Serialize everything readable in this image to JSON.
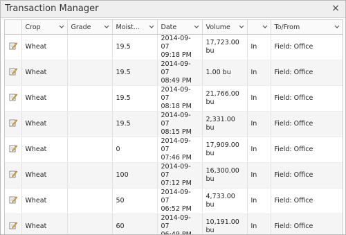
{
  "window": {
    "title": "Transaction Manager",
    "close_glyph": "×"
  },
  "columns": [
    {
      "label": ""
    },
    {
      "label": "Crop"
    },
    {
      "label": "Grade"
    },
    {
      "label": "Moist..."
    },
    {
      "label": "Date"
    },
    {
      "label": "Volume"
    },
    {
      "label": ""
    },
    {
      "label": "To/From"
    }
  ],
  "rows": [
    {
      "crop": "Wheat",
      "grade": "",
      "moisture": "19.5",
      "date": "2014-09-07",
      "time": "09:18 PM",
      "volume": "17,723.00 bu",
      "direction": "In",
      "to_from": "Field: Office"
    },
    {
      "crop": "Wheat",
      "grade": "",
      "moisture": "19.5",
      "date": "2014-09-07",
      "time": "08:49 PM",
      "volume": "1.00 bu",
      "direction": "In",
      "to_from": "Field: Office"
    },
    {
      "crop": "Wheat",
      "grade": "",
      "moisture": "19.5",
      "date": "2014-09-07",
      "time": "08:18 PM",
      "volume": "21,766.00 bu",
      "direction": "In",
      "to_from": "Field: Office"
    },
    {
      "crop": "Wheat",
      "grade": "",
      "moisture": "19.5",
      "date": "2014-09-07",
      "time": "08:15 PM",
      "volume": "2,331.00 bu",
      "direction": "In",
      "to_from": "Field: Office"
    },
    {
      "crop": "Wheat",
      "grade": "",
      "moisture": "0",
      "date": "2014-09-07",
      "time": "07:46 PM",
      "volume": "17,909.00 bu",
      "direction": "In",
      "to_from": "Field: Office"
    },
    {
      "crop": "Wheat",
      "grade": "",
      "moisture": "100",
      "date": "2014-09-07",
      "time": "07:12 PM",
      "volume": "16,300.00 bu",
      "direction": "In",
      "to_from": "Field: Office"
    },
    {
      "crop": "Wheat",
      "grade": "",
      "moisture": "50",
      "date": "2014-09-07",
      "time": "06:52 PM",
      "volume": "4,733.00 bu",
      "direction": "In",
      "to_from": "Field: Office"
    },
    {
      "crop": "Wheat",
      "grade": "",
      "moisture": "60",
      "date": "2014-09-07",
      "time": "06:49 PM",
      "volume": "10,191.00 bu",
      "direction": "In",
      "to_from": "Field: Office"
    }
  ],
  "icons": {
    "row_action": "edit-icon",
    "column_menu": "chevron-down-icon",
    "close": "close-icon"
  }
}
